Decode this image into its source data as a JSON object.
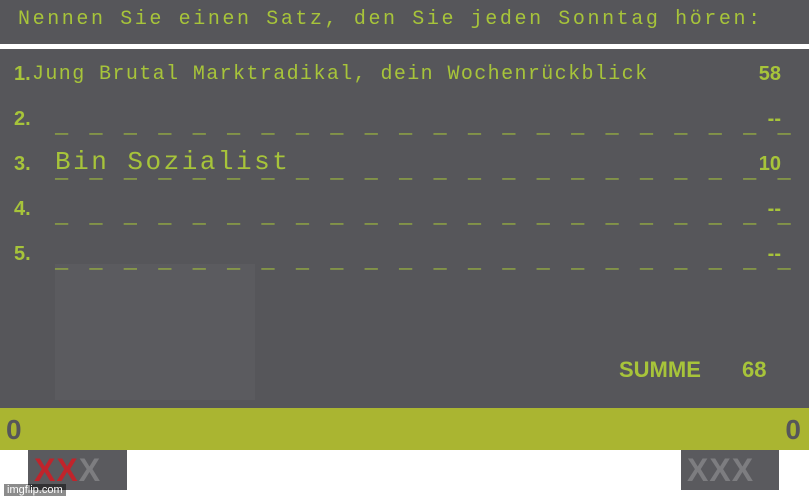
{
  "question": "Nennen Sie einen Satz, den Sie jeden Sonntag hören:",
  "rows": [
    {
      "num": "1.",
      "answer": "Jung Brutal Marktradikal, dein Wochenrückblick",
      "points": "58"
    },
    {
      "num": "2.",
      "blank": "_ _ _ _ _ _ _ _ _ _ _ _ _ _ _ _ _ _ _ _ _ _",
      "points": "--"
    },
    {
      "num": "3.",
      "answer": "Bin Sozialist",
      "points": "10"
    },
    {
      "num": "4.",
      "blank": "_ _ _ _ _ _ _ _ _ _ _ _ _ _ _ _ _ _ _ _ _ _",
      "points": "--"
    },
    {
      "num": "5.",
      "blank": "_ _ _ _ _ _ _ _ _ _ _ _ _ _ _ _ _ _ _ _ _ _",
      "points": "--"
    }
  ],
  "row3_trailing_blank": "_ _ _ _ _ _ _ _ _ _ _ _ _ _ _ _ _ _ _ _ _ _",
  "sum": {
    "label": "SUMME",
    "value": "68"
  },
  "score": {
    "left": "0",
    "right": "0"
  },
  "strikes": {
    "left": {
      "active": 2,
      "total": 3,
      "glyph": "X"
    },
    "right": {
      "active": 0,
      "total": 3,
      "glyph": "X"
    }
  },
  "watermark": "imgflip.com",
  "colors": {
    "board": "#56565a",
    "text": "#a7c43a",
    "score_bar": "#aab531",
    "strike_active": "#c0242b",
    "strike_inactive": "#7d7d80"
  }
}
